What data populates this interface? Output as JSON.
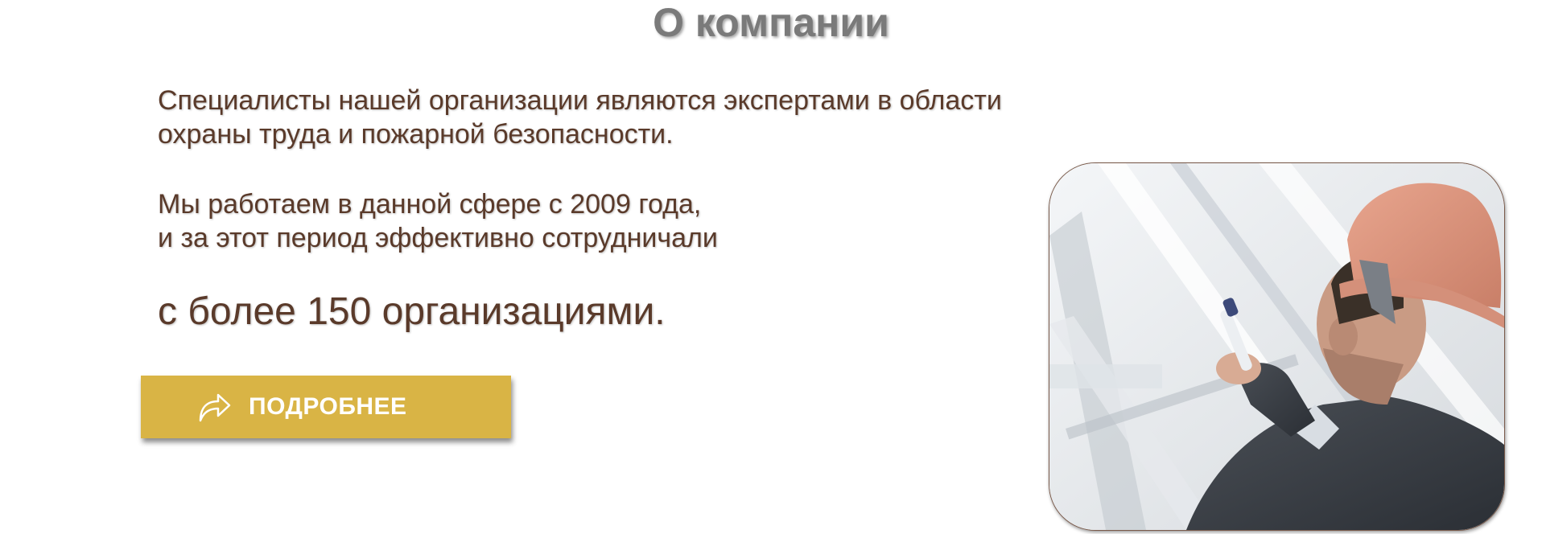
{
  "section": {
    "title": "О компании"
  },
  "intro": {
    "line1": "Специалисты нашей организации являются экспертами в области",
    "line2": "охраны труда и пожарной безопасности."
  },
  "experience": {
    "line1": "Мы работаем в данной сфере с 2009 года,",
    "line2": "и за этот период эффективно сотрудничали"
  },
  "highlight": {
    "text": "с более 150 организациями."
  },
  "more_button": {
    "label": "ПОДРОБНЕЕ",
    "icon": "share-arrow-icon",
    "color": "#d9b445"
  },
  "photo": {
    "subject": "engineer-in-hard-hat"
  },
  "colors": {
    "title": "#7a7a7a",
    "text": "#5a3a2a",
    "button": "#d9b445"
  }
}
